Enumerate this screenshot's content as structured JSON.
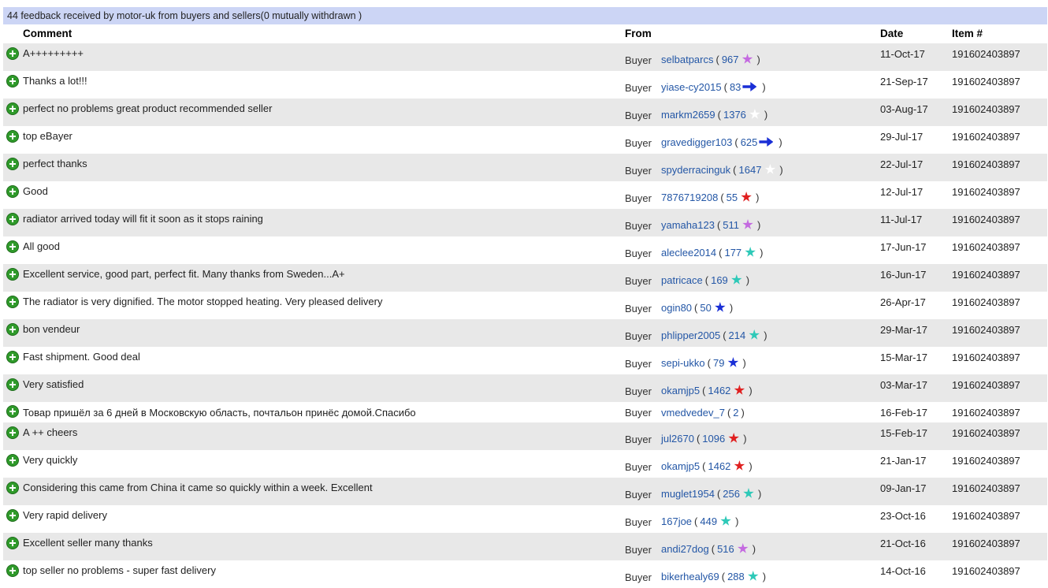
{
  "banner": "44 feedback received by motor-uk from buyers and sellers(0 mutually withdrawn )",
  "headers": {
    "comment": "Comment",
    "from": "From",
    "date": "Date",
    "item": "Item #"
  },
  "rows": [
    {
      "comment": "A+++++++++",
      "from": "Buyer",
      "user": "selbatparcs",
      "score": "967",
      "star": "purple",
      "date": "11-Oct-17",
      "item": "191602403897"
    },
    {
      "comment": "Thanks a lot!!!",
      "from": "Buyer",
      "user": "yiase-cy2015",
      "score": "83",
      "star": "shooting",
      "date": "21-Sep-17",
      "item": "191602403897"
    },
    {
      "comment": "perfect no problems great product recommended seller",
      "from": "Buyer",
      "user": "markm2659",
      "score": "1376",
      "star": "white",
      "date": "03-Aug-17",
      "item": "191602403897"
    },
    {
      "comment": "top eBayer",
      "from": "Buyer",
      "user": "gravedigger103",
      "score": "625",
      "star": "shooting",
      "date": "29-Jul-17",
      "item": "191602403897"
    },
    {
      "comment": "perfect thanks",
      "from": "Buyer",
      "user": "spyderracinguk",
      "score": "1647",
      "star": "white",
      "date": "22-Jul-17",
      "item": "191602403897"
    },
    {
      "comment": "Good",
      "from": "Buyer",
      "user": "7876719208",
      "score": "55",
      "star": "red",
      "date": "12-Jul-17",
      "item": "191602403897"
    },
    {
      "comment": "radiator arrived today will fit it soon as it stops raining",
      "from": "Buyer",
      "user": "yamaha123",
      "score": "511",
      "star": "purple",
      "date": "11-Jul-17",
      "item": "191602403897"
    },
    {
      "comment": "All good",
      "from": "Buyer",
      "user": "aleclee2014",
      "score": "177",
      "star": "turquoise",
      "date": "17-Jun-17",
      "item": "191602403897"
    },
    {
      "comment": "Excellent service, good part, perfect fit. Many thanks from Sweden...A+",
      "from": "Buyer",
      "user": "patricace",
      "score": "169",
      "star": "turquoise",
      "date": "16-Jun-17",
      "item": "191602403897"
    },
    {
      "comment": "The radiator is very dignified. The motor stopped heating. Very pleased delivery",
      "from": "Buyer",
      "user": "ogin80",
      "score": "50",
      "star": "blue",
      "date": "26-Apr-17",
      "item": "191602403897"
    },
    {
      "comment": "bon vendeur",
      "from": "Buyer",
      "user": "phlipper2005",
      "score": "214",
      "star": "turquoise",
      "date": "29-Mar-17",
      "item": "191602403897"
    },
    {
      "comment": "Fast shipment. Good deal",
      "from": "Buyer",
      "user": "sepi-ukko",
      "score": "79",
      "star": "blue",
      "date": "15-Mar-17",
      "item": "191602403897"
    },
    {
      "comment": "Very satisfied",
      "from": "Buyer",
      "user": "okamjp5",
      "score": "1462",
      "star": "red",
      "date": "03-Mar-17",
      "item": "191602403897"
    },
    {
      "comment": "Товар пришёл за 6 дней в Московскую область, почтальон принёс домой.Спасибо",
      "from": "Buyer",
      "user": "vmedvedev_7",
      "score": "2",
      "star": "",
      "date": "16-Feb-17",
      "item": "191602403897",
      "short": true
    },
    {
      "comment": "A ++ cheers",
      "from": "Buyer",
      "user": "jul2670",
      "score": "1096",
      "star": "red",
      "date": "15-Feb-17",
      "item": "191602403897"
    },
    {
      "comment": "Very quickly",
      "from": "Buyer",
      "user": "okamjp5",
      "score": "1462",
      "star": "red",
      "date": "21-Jan-17",
      "item": "191602403897"
    },
    {
      "comment": "Considering this came from China it came so quickly within a week. Excellent",
      "from": "Buyer",
      "user": "muglet1954",
      "score": "256",
      "star": "turquoise",
      "date": "09-Jan-17",
      "item": "191602403897"
    },
    {
      "comment": "Very rapid delivery",
      "from": "Buyer",
      "user": "167joe",
      "score": "449",
      "star": "turquoise",
      "date": "23-Oct-16",
      "item": "191602403897"
    },
    {
      "comment": "Excellent seller many thanks",
      "from": "Buyer",
      "user": "andi27dog",
      "score": "516",
      "star": "purple",
      "date": "21-Oct-16",
      "item": "191602403897"
    },
    {
      "comment": "top seller no problems - super fast delivery",
      "from": "Buyer",
      "user": "bikerhealy69",
      "score": "288",
      "star": "turquoise",
      "date": "14-Oct-16",
      "item": "191602403897"
    }
  ]
}
